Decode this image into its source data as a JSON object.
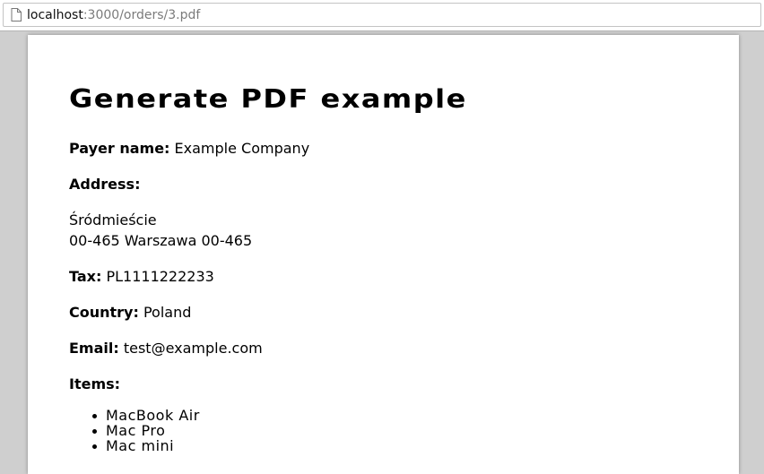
{
  "browser": {
    "url_host": "localhost",
    "url_rest": ":3000/orders/3.pdf"
  },
  "document": {
    "title": "Generate PDF example",
    "payer_label": "Payer name:",
    "payer_value": " Example Company",
    "address_label": "Address:",
    "address_line1": "Śródmieście",
    "address_line2": "00-465 Warszawa 00-465",
    "tax_label": "Tax:",
    "tax_value": " PL1111222233",
    "country_label": "Country:",
    "country_value": " Poland",
    "email_label": "Email:",
    "email_value": " test@example.com",
    "items_label": "Items:",
    "items": [
      "MacBook Air",
      "Mac Pro",
      "Mac mini"
    ]
  }
}
